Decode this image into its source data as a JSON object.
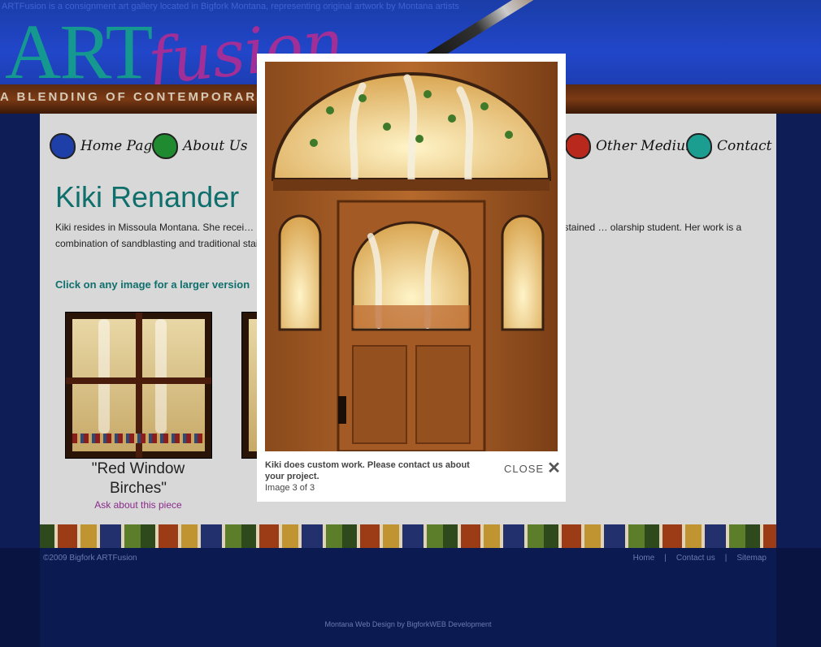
{
  "header": {
    "tagline": "ARTFusion is a consignment art gallery located in Bigfork Montana, representing original artwork by Montana artists",
    "logo_art": "ART",
    "logo_fusion": "fusion",
    "blend_text": "A BLENDING OF   CONTEMPORARY"
  },
  "nav": [
    {
      "label": "Home Page",
      "color": "#1f3fa8"
    },
    {
      "label": "About Us",
      "color": "#1f8a2f"
    },
    {
      "label": "Other Mediums",
      "color": "#b8281d"
    },
    {
      "label": "Contact",
      "color": "#1b9e90"
    }
  ],
  "page": {
    "title": "Kiki Renander",
    "bio": "Kiki resides in Missoula Montana. She recei… ceship with Bordeleau Glass in Sun Valley Idaho, she decided to make stained … olarship student. Her work is a combination of sandblasting and traditional stained glass… wooden windows.",
    "click_hint": "Click on any image for a larger version"
  },
  "thumbnails": [
    {
      "caption": "\"Red Window Birches\"",
      "link": "Ask about this piece"
    }
  ],
  "lightbox": {
    "caption": "Kiki does custom work. Please contact us about your project.",
    "count": "Image 3 of 3",
    "close_label": "CLOSE",
    "close_icon": "✕"
  },
  "footer": {
    "copyright": "©2009 Bigfork ARTFusion",
    "links": [
      "Home",
      "Contact us",
      "Sitemap"
    ],
    "separator": "|",
    "credit": "Montana Web Design by BigforkWEB Development"
  }
}
